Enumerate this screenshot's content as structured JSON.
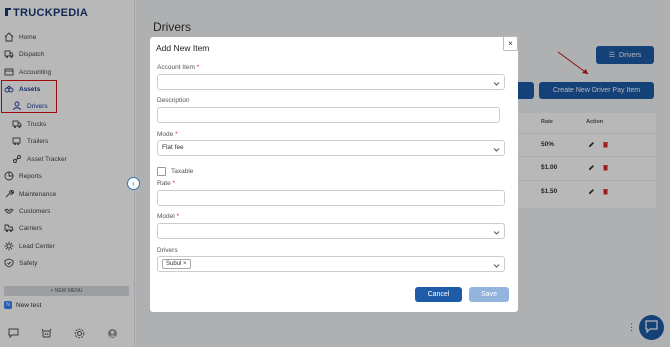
{
  "app": {
    "logo_text": "TRUCKPEDIA"
  },
  "sidebar": {
    "items": [
      {
        "label": "Home",
        "icon": "home-icon"
      },
      {
        "label": "Dispatch",
        "icon": "truck-icon"
      },
      {
        "label": "Accounting",
        "icon": "wallet-icon"
      },
      {
        "label": "Assets",
        "icon": "assets-icon"
      },
      {
        "label": "Drivers",
        "icon": "person-icon"
      },
      {
        "label": "Trucks",
        "icon": "truck-icon"
      },
      {
        "label": "Trailers",
        "icon": "trailer-icon"
      },
      {
        "label": "Asset Tracker",
        "icon": "tracker-icon"
      },
      {
        "label": "Reports",
        "icon": "chart-icon"
      },
      {
        "label": "Maintenance",
        "icon": "wrench-icon"
      },
      {
        "label": "Customers",
        "icon": "handshake-icon"
      },
      {
        "label": "Carriers",
        "icon": "carrier-icon"
      },
      {
        "label": "Lead Center",
        "icon": "gear-icon"
      },
      {
        "label": "Safety",
        "icon": "shield-icon"
      }
    ],
    "new_menu_label": "+ NEW MENU",
    "custom_item": {
      "badge": "N",
      "label": "New test"
    }
  },
  "main": {
    "title": "Drivers",
    "drivers_button": "Drivers",
    "partial_button": "n",
    "create_button": "Create New Driver Pay Item",
    "table": {
      "headers": [
        "Rate",
        "Action"
      ],
      "rows": [
        {
          "rate": "50%"
        },
        {
          "rate": "$1.00"
        },
        {
          "rate": "$1.50"
        }
      ]
    }
  },
  "modal": {
    "title": "Add New Item",
    "close_label": "×",
    "account_item": {
      "label": "Account Item",
      "required": "*",
      "value": ""
    },
    "description": {
      "label": "Description",
      "value": ""
    },
    "mode": {
      "label": "Mode",
      "required": "*",
      "value": "Flat fee"
    },
    "taxable": {
      "label": "Taxable",
      "checked": false
    },
    "rate": {
      "label": "Rate",
      "required": "*",
      "value": ""
    },
    "model": {
      "label": "Model",
      "required": "*",
      "value": ""
    },
    "drivers": {
      "label": "Drivers",
      "chips": [
        {
          "label": "Subul",
          "remove": "×"
        }
      ]
    },
    "cancel_label": "Cancel",
    "save_label": "Save"
  },
  "colors": {
    "primary": "#1e5ba8",
    "highlight": "#dd1111",
    "danger": "#dc2626"
  }
}
